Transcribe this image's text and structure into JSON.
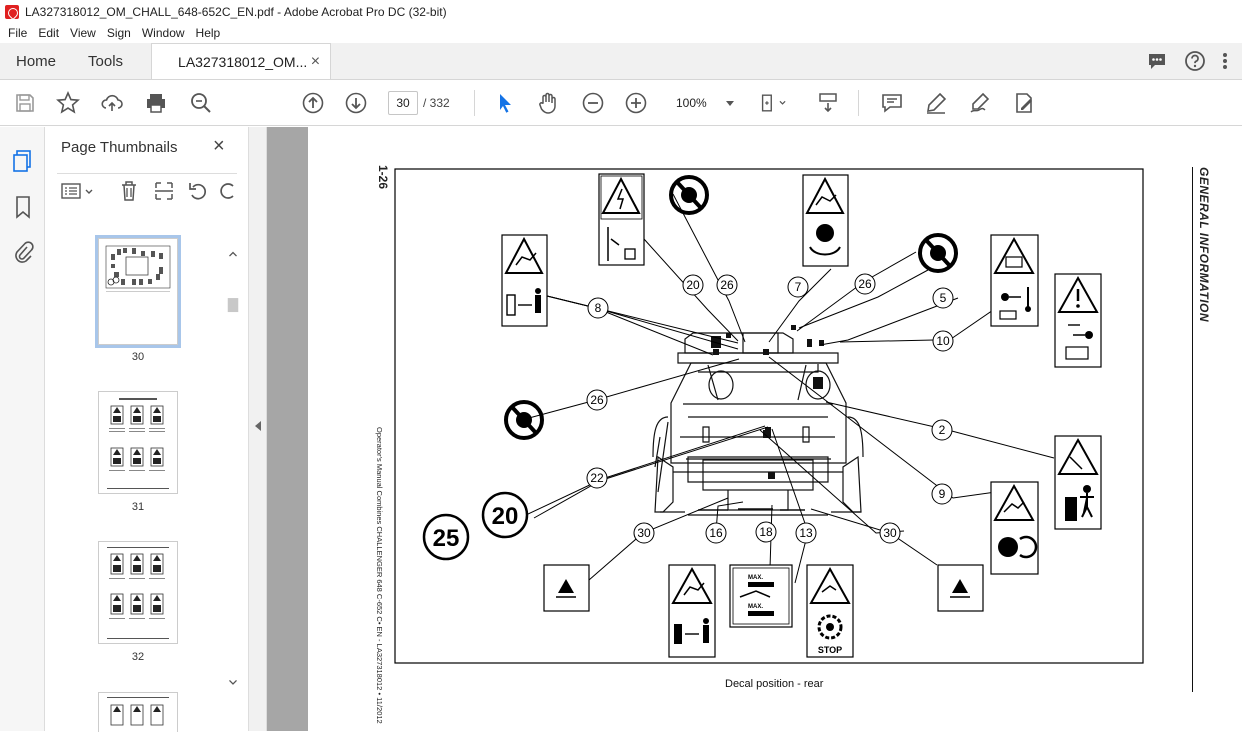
{
  "window": {
    "title": "LA327318012_OM_CHALL_648-652C_EN.pdf - Adobe Acrobat Pro DC (32-bit)"
  },
  "menu": [
    "File",
    "Edit",
    "View",
    "Sign",
    "Window",
    "Help"
  ],
  "tabs": {
    "home": "Home",
    "tools": "Tools",
    "document": "LA327318012_OM...",
    "close": "×"
  },
  "toolbar": {
    "page_current": "30",
    "page_total": "/ 332",
    "zoom": "100%"
  },
  "sidebar": {
    "title": "Page Thumbnails",
    "close": "×",
    "thumbnails": [
      {
        "label": "30"
      },
      {
        "label": "31"
      },
      {
        "label": "32"
      }
    ]
  },
  "document": {
    "page_number": "1-26",
    "side_heading": "GENERAL INFORMATION",
    "footer_vertical": "Operator's Manual Combines CHALLENGER 648 C-652 C• EN - LA327318012 • 11/2012",
    "caption": "Decal position - rear",
    "callouts": [
      "20",
      "26",
      "7",
      "26",
      "5",
      "8",
      "10",
      "26",
      "2",
      "9",
      "22",
      "30",
      "16",
      "18",
      "13",
      "30"
    ],
    "large_numbers": [
      "25",
      "20"
    ],
    "decal_text": {
      "stop": "STOP",
      "max1": "MAX.",
      "max2": "MAX."
    }
  }
}
